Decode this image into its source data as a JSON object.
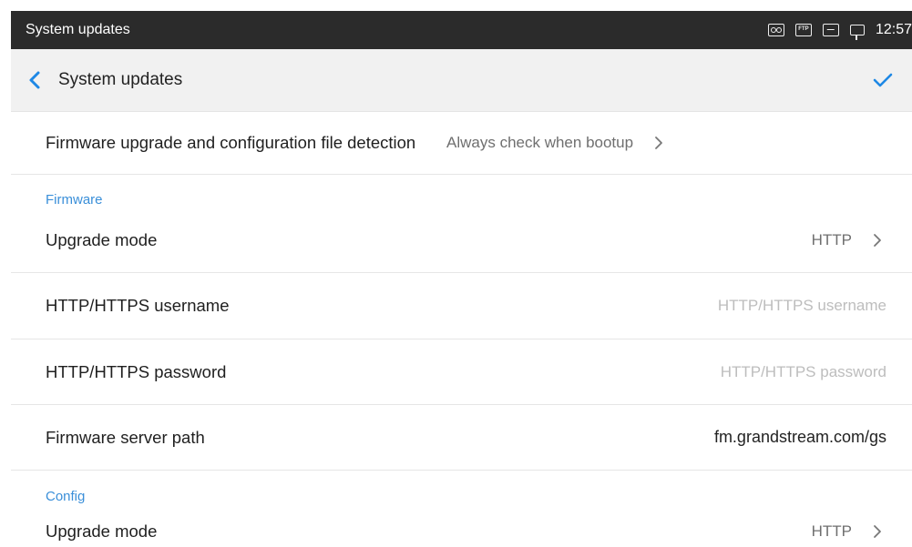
{
  "status_bar": {
    "title": "System updates",
    "time": "12:57",
    "icons": [
      "voicemail-icon",
      "ftp-icon",
      "image-icon",
      "network-icon"
    ]
  },
  "app_bar": {
    "title": "System updates",
    "back_icon": "chevron-left-icon",
    "confirm_icon": "checkmark-icon",
    "accent": "#1e88e5"
  },
  "rows": {
    "detection": {
      "label": "Firmware upgrade and configuration file detection",
      "value": "Always check when bootup"
    },
    "firmware_section": "Firmware",
    "fw_upgrade_mode": {
      "label": "Upgrade mode",
      "value": "HTTP"
    },
    "fw_username": {
      "label": "HTTP/HTTPS username",
      "placeholder": "HTTP/HTTPS username"
    },
    "fw_password": {
      "label": "HTTP/HTTPS password",
      "placeholder": "HTTP/HTTPS password"
    },
    "fw_server_path": {
      "label": "Firmware server path",
      "value": "fm.grandstream.com/gs"
    },
    "config_section": "Config",
    "cfg_upgrade_mode": {
      "label": "Upgrade mode",
      "value": "HTTP"
    }
  },
  "colors": {
    "section_header": "#3a8fd9",
    "status_bar_bg": "#2b2b2b",
    "app_bar_bg": "#f1f1f1"
  }
}
